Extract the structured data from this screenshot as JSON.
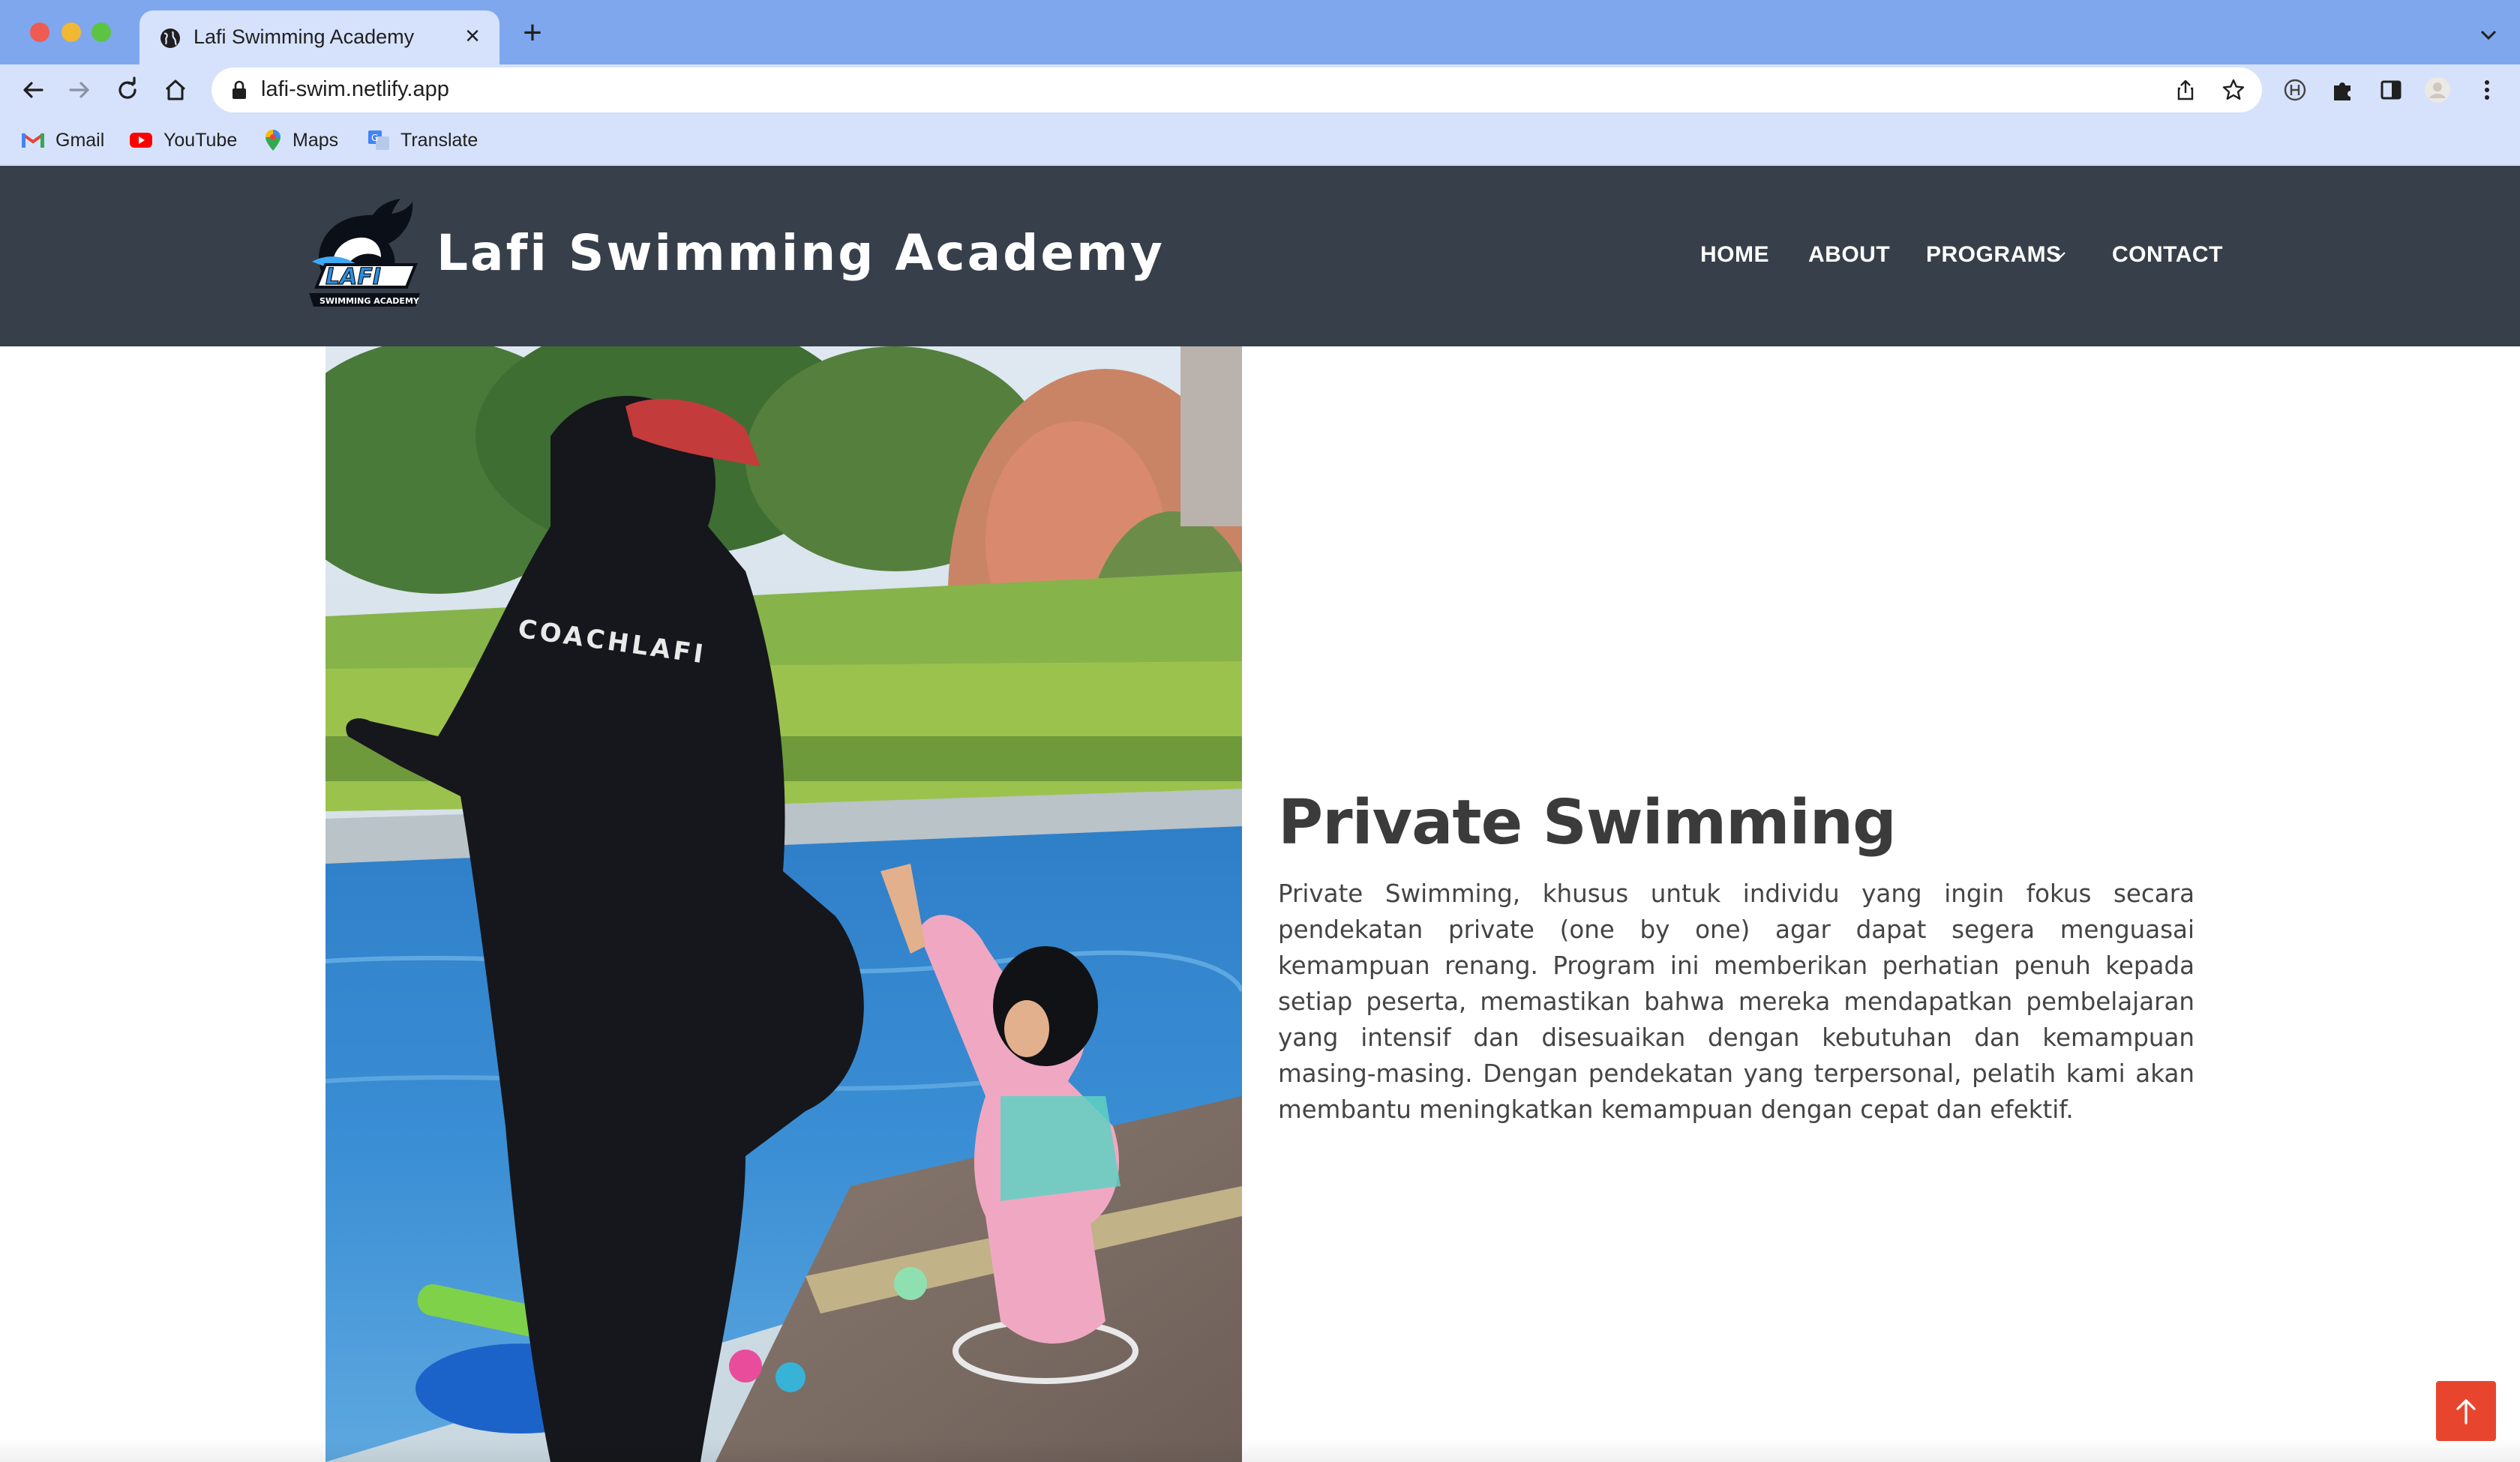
{
  "browser": {
    "tab_title": "Lafi Swimming Academy",
    "tab_close": "×",
    "new_tab": "+",
    "url": "lafi-swim.netlify.app",
    "bookmarks": [
      {
        "label": "Gmail",
        "icon": "gmail-icon"
      },
      {
        "label": "YouTube",
        "icon": "youtube-icon"
      },
      {
        "label": "Maps",
        "icon": "maps-icon"
      },
      {
        "label": "Translate",
        "icon": "translate-icon"
      }
    ]
  },
  "site": {
    "brand": "Lafi Swimming Academy",
    "logo_text": "LAFI",
    "logo_subtext": "SWIMMING ACADEMY",
    "nav": {
      "home": "HOME",
      "about": "ABOUT",
      "programs": "PROGRAMS",
      "contact": "CONTACT"
    },
    "header_color": "#37404a"
  },
  "main": {
    "image_shirt_text": "COACHLAFI",
    "title": "Private Swimming",
    "description": "Private Swimming, khusus untuk individu yang ingin fokus secara pendekatan private (one by one) agar dapat segera menguasai kemampuan renang. Program ini memberikan perhatian penuh kepada setiap peserta, memastikan bahwa mereka mendapatkan pembelajaran yang intensif dan disesuaikan dengan kebutuhan dan kemampuan masing-masing. Dengan pendekatan yang terpersonal, pelatih kami akan membantu meningkatkan kemampuan dengan cepat dan efektif."
  },
  "scroll_top": {
    "icon": "arrow-up-icon",
    "color": "#e8452f"
  }
}
